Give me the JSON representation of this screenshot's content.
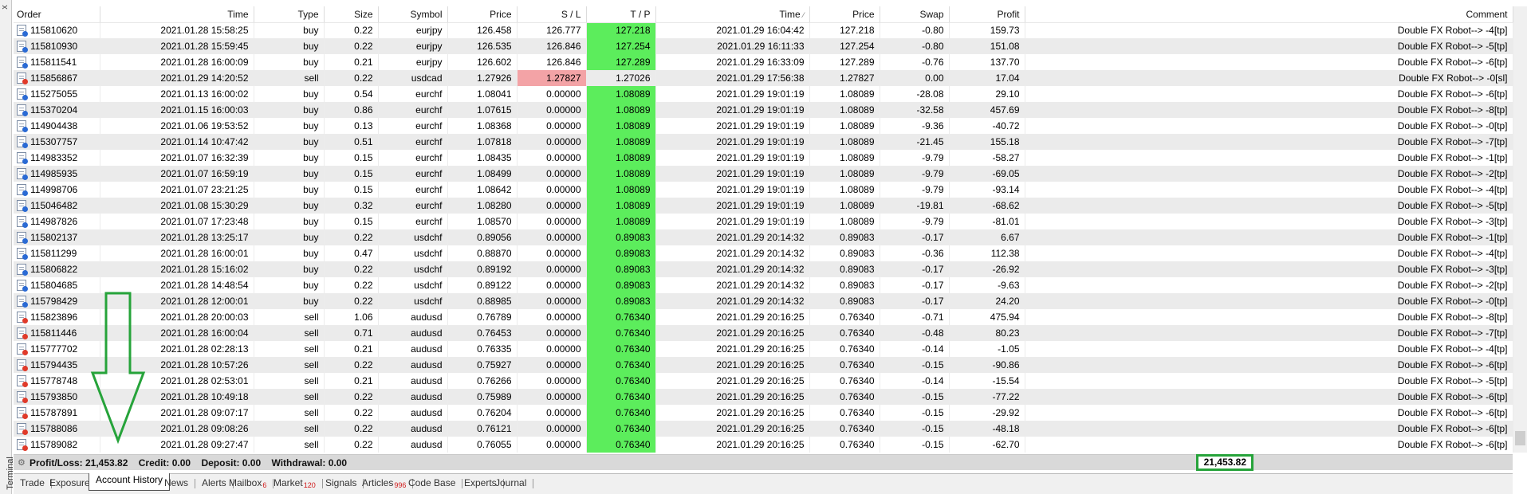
{
  "window": {
    "terminal_label": "Terminal",
    "close_glyph": "x"
  },
  "columns": {
    "order": "Order",
    "time": "Time",
    "type": "Type",
    "size": "Size",
    "symbol": "Symbol",
    "price": "Price",
    "sl": "S / L",
    "tp": "T / P",
    "close_time": "Time",
    "close_price": "Price",
    "swap": "Swap",
    "profit": "Profit",
    "comment": "Comment"
  },
  "rows": [
    {
      "order": "115810620",
      "time": "2021.01.28 15:58:25",
      "type": "buy",
      "size": "0.22",
      "symbol": "eurjpy",
      "price": "126.458",
      "sl": "126.777",
      "tp": "127.218",
      "close_time": "2021.01.29 16:04:42",
      "close_price": "127.218",
      "swap": "-0.80",
      "profit": "159.73",
      "comment": "Double FX Robot--> -4[tp]",
      "hit": "tp"
    },
    {
      "order": "115810930",
      "time": "2021.01.28 15:59:45",
      "type": "buy",
      "size": "0.22",
      "symbol": "eurjpy",
      "price": "126.535",
      "sl": "126.846",
      "tp": "127.254",
      "close_time": "2021.01.29 16:11:33",
      "close_price": "127.254",
      "swap": "-0.80",
      "profit": "151.08",
      "comment": "Double FX Robot--> -5[tp]",
      "hit": "tp"
    },
    {
      "order": "115811541",
      "time": "2021.01.28 16:00:09",
      "type": "buy",
      "size": "0.21",
      "symbol": "eurjpy",
      "price": "126.602",
      "sl": "126.846",
      "tp": "127.289",
      "close_time": "2021.01.29 16:33:09",
      "close_price": "127.289",
      "swap": "-0.76",
      "profit": "137.70",
      "comment": "Double FX Robot--> -6[tp]",
      "hit": "tp"
    },
    {
      "order": "115856867",
      "time": "2021.01.29 14:20:52",
      "type": "sell",
      "size": "0.22",
      "symbol": "usdcad",
      "price": "1.27926",
      "sl": "1.27827",
      "tp": "1.27026",
      "close_time": "2021.01.29 17:56:38",
      "close_price": "1.27827",
      "swap": "0.00",
      "profit": "17.04",
      "comment": "Double FX Robot--> -0[sl]",
      "hit": "sl"
    },
    {
      "order": "115275055",
      "time": "2021.01.13 16:00:02",
      "type": "buy",
      "size": "0.54",
      "symbol": "eurchf",
      "price": "1.08041",
      "sl": "0.00000",
      "tp": "1.08089",
      "close_time": "2021.01.29 19:01:19",
      "close_price": "1.08089",
      "swap": "-28.08",
      "profit": "29.10",
      "comment": "Double FX Robot--> -6[tp]",
      "hit": "tp"
    },
    {
      "order": "115370204",
      "time": "2021.01.15 16:00:03",
      "type": "buy",
      "size": "0.86",
      "symbol": "eurchf",
      "price": "1.07615",
      "sl": "0.00000",
      "tp": "1.08089",
      "close_time": "2021.01.29 19:01:19",
      "close_price": "1.08089",
      "swap": "-32.58",
      "profit": "457.69",
      "comment": "Double FX Robot--> -8[tp]",
      "hit": "tp"
    },
    {
      "order": "114904438",
      "time": "2021.01.06 19:53:52",
      "type": "buy",
      "size": "0.13",
      "symbol": "eurchf",
      "price": "1.08368",
      "sl": "0.00000",
      "tp": "1.08089",
      "close_time": "2021.01.29 19:01:19",
      "close_price": "1.08089",
      "swap": "-9.36",
      "profit": "-40.72",
      "comment": "Double FX Robot--> -0[tp]",
      "hit": "tp"
    },
    {
      "order": "115307757",
      "time": "2021.01.14 10:47:42",
      "type": "buy",
      "size": "0.51",
      "symbol": "eurchf",
      "price": "1.07818",
      "sl": "0.00000",
      "tp": "1.08089",
      "close_time": "2021.01.29 19:01:19",
      "close_price": "1.08089",
      "swap": "-21.45",
      "profit": "155.18",
      "comment": "Double FX Robot--> -7[tp]",
      "hit": "tp"
    },
    {
      "order": "114983352",
      "time": "2021.01.07 16:32:39",
      "type": "buy",
      "size": "0.15",
      "symbol": "eurchf",
      "price": "1.08435",
      "sl": "0.00000",
      "tp": "1.08089",
      "close_time": "2021.01.29 19:01:19",
      "close_price": "1.08089",
      "swap": "-9.79",
      "profit": "-58.27",
      "comment": "Double FX Robot--> -1[tp]",
      "hit": "tp"
    },
    {
      "order": "114985935",
      "time": "2021.01.07 16:59:19",
      "type": "buy",
      "size": "0.15",
      "symbol": "eurchf",
      "price": "1.08499",
      "sl": "0.00000",
      "tp": "1.08089",
      "close_time": "2021.01.29 19:01:19",
      "close_price": "1.08089",
      "swap": "-9.79",
      "profit": "-69.05",
      "comment": "Double FX Robot--> -2[tp]",
      "hit": "tp"
    },
    {
      "order": "114998706",
      "time": "2021.01.07 23:21:25",
      "type": "buy",
      "size": "0.15",
      "symbol": "eurchf",
      "price": "1.08642",
      "sl": "0.00000",
      "tp": "1.08089",
      "close_time": "2021.01.29 19:01:19",
      "close_price": "1.08089",
      "swap": "-9.79",
      "profit": "-93.14",
      "comment": "Double FX Robot--> -4[tp]",
      "hit": "tp"
    },
    {
      "order": "115046482",
      "time": "2021.01.08 15:30:29",
      "type": "buy",
      "size": "0.32",
      "symbol": "eurchf",
      "price": "1.08280",
      "sl": "0.00000",
      "tp": "1.08089",
      "close_time": "2021.01.29 19:01:19",
      "close_price": "1.08089",
      "swap": "-19.81",
      "profit": "-68.62",
      "comment": "Double FX Robot--> -5[tp]",
      "hit": "tp"
    },
    {
      "order": "114987826",
      "time": "2021.01.07 17:23:48",
      "type": "buy",
      "size": "0.15",
      "symbol": "eurchf",
      "price": "1.08570",
      "sl": "0.00000",
      "tp": "1.08089",
      "close_time": "2021.01.29 19:01:19",
      "close_price": "1.08089",
      "swap": "-9.79",
      "profit": "-81.01",
      "comment": "Double FX Robot--> -3[tp]",
      "hit": "tp"
    },
    {
      "order": "115802137",
      "time": "2021.01.28 13:25:17",
      "type": "buy",
      "size": "0.22",
      "symbol": "usdchf",
      "price": "0.89056",
      "sl": "0.00000",
      "tp": "0.89083",
      "close_time": "2021.01.29 20:14:32",
      "close_price": "0.89083",
      "swap": "-0.17",
      "profit": "6.67",
      "comment": "Double FX Robot--> -1[tp]",
      "hit": "tp"
    },
    {
      "order": "115811299",
      "time": "2021.01.28 16:00:01",
      "type": "buy",
      "size": "0.47",
      "symbol": "usdchf",
      "price": "0.88870",
      "sl": "0.00000",
      "tp": "0.89083",
      "close_time": "2021.01.29 20:14:32",
      "close_price": "0.89083",
      "swap": "-0.36",
      "profit": "112.38",
      "comment": "Double FX Robot--> -4[tp]",
      "hit": "tp"
    },
    {
      "order": "115806822",
      "time": "2021.01.28 15:16:02",
      "type": "buy",
      "size": "0.22",
      "symbol": "usdchf",
      "price": "0.89192",
      "sl": "0.00000",
      "tp": "0.89083",
      "close_time": "2021.01.29 20:14:32",
      "close_price": "0.89083",
      "swap": "-0.17",
      "profit": "-26.92",
      "comment": "Double FX Robot--> -3[tp]",
      "hit": "tp"
    },
    {
      "order": "115804685",
      "time": "2021.01.28 14:48:54",
      "type": "buy",
      "size": "0.22",
      "symbol": "usdchf",
      "price": "0.89122",
      "sl": "0.00000",
      "tp": "0.89083",
      "close_time": "2021.01.29 20:14:32",
      "close_price": "0.89083",
      "swap": "-0.17",
      "profit": "-9.63",
      "comment": "Double FX Robot--> -2[tp]",
      "hit": "tp"
    },
    {
      "order": "115798429",
      "time": "2021.01.28 12:00:01",
      "type": "buy",
      "size": "0.22",
      "symbol": "usdchf",
      "price": "0.88985",
      "sl": "0.00000",
      "tp": "0.89083",
      "close_time": "2021.01.29 20:14:32",
      "close_price": "0.89083",
      "swap": "-0.17",
      "profit": "24.20",
      "comment": "Double FX Robot--> -0[tp]",
      "hit": "tp"
    },
    {
      "order": "115823896",
      "time": "2021.01.28 20:00:03",
      "type": "sell",
      "size": "1.06",
      "symbol": "audusd",
      "price": "0.76789",
      "sl": "0.00000",
      "tp": "0.76340",
      "close_time": "2021.01.29 20:16:25",
      "close_price": "0.76340",
      "swap": "-0.71",
      "profit": "475.94",
      "comment": "Double FX Robot--> -8[tp]",
      "hit": "tp"
    },
    {
      "order": "115811446",
      "time": "2021.01.28 16:00:04",
      "type": "sell",
      "size": "0.71",
      "symbol": "audusd",
      "price": "0.76453",
      "sl": "0.00000",
      "tp": "0.76340",
      "close_time": "2021.01.29 20:16:25",
      "close_price": "0.76340",
      "swap": "-0.48",
      "profit": "80.23",
      "comment": "Double FX Robot--> -7[tp]",
      "hit": "tp"
    },
    {
      "order": "115777702",
      "time": "2021.01.28 02:28:13",
      "type": "sell",
      "size": "0.21",
      "symbol": "audusd",
      "price": "0.76335",
      "sl": "0.00000",
      "tp": "0.76340",
      "close_time": "2021.01.29 20:16:25",
      "close_price": "0.76340",
      "swap": "-0.14",
      "profit": "-1.05",
      "comment": "Double FX Robot--> -4[tp]",
      "hit": "tp"
    },
    {
      "order": "115794435",
      "time": "2021.01.28 10:57:26",
      "type": "sell",
      "size": "0.22",
      "symbol": "audusd",
      "price": "0.75927",
      "sl": "0.00000",
      "tp": "0.76340",
      "close_time": "2021.01.29 20:16:25",
      "close_price": "0.76340",
      "swap": "-0.15",
      "profit": "-90.86",
      "comment": "Double FX Robot--> -6[tp]",
      "hit": "tp"
    },
    {
      "order": "115778748",
      "time": "2021.01.28 02:53:01",
      "type": "sell",
      "size": "0.21",
      "symbol": "audusd",
      "price": "0.76266",
      "sl": "0.00000",
      "tp": "0.76340",
      "close_time": "2021.01.29 20:16:25",
      "close_price": "0.76340",
      "swap": "-0.14",
      "profit": "-15.54",
      "comment": "Double FX Robot--> -5[tp]",
      "hit": "tp"
    },
    {
      "order": "115793850",
      "time": "2021.01.28 10:49:18",
      "type": "sell",
      "size": "0.22",
      "symbol": "audusd",
      "price": "0.75989",
      "sl": "0.00000",
      "tp": "0.76340",
      "close_time": "2021.01.29 20:16:25",
      "close_price": "0.76340",
      "swap": "-0.15",
      "profit": "-77.22",
      "comment": "Double FX Robot--> -6[tp]",
      "hit": "tp"
    },
    {
      "order": "115787891",
      "time": "2021.01.28 09:07:17",
      "type": "sell",
      "size": "0.22",
      "symbol": "audusd",
      "price": "0.76204",
      "sl": "0.00000",
      "tp": "0.76340",
      "close_time": "2021.01.29 20:16:25",
      "close_price": "0.76340",
      "swap": "-0.15",
      "profit": "-29.92",
      "comment": "Double FX Robot--> -6[tp]",
      "hit": "tp"
    },
    {
      "order": "115788086",
      "time": "2021.01.28 09:08:26",
      "type": "sell",
      "size": "0.22",
      "symbol": "audusd",
      "price": "0.76121",
      "sl": "0.00000",
      "tp": "0.76340",
      "close_time": "2021.01.29 20:16:25",
      "close_price": "0.76340",
      "swap": "-0.15",
      "profit": "-48.18",
      "comment": "Double FX Robot--> -6[tp]",
      "hit": "tp"
    },
    {
      "order": "115789082",
      "time": "2021.01.28 09:27:47",
      "type": "sell",
      "size": "0.22",
      "symbol": "audusd",
      "price": "0.76055",
      "sl": "0.00000",
      "tp": "0.76340",
      "close_time": "2021.01.29 20:16:25",
      "close_price": "0.76340",
      "swap": "-0.15",
      "profit": "-62.70",
      "comment": "Double FX Robot--> -6[tp]",
      "hit": "tp"
    }
  ],
  "summary": {
    "profit_loss": "Profit/Loss: 21,453.82",
    "credit": "Credit: 0.00",
    "deposit": "Deposit: 0.00",
    "withdrawal": "Withdrawal: 0.00",
    "total_profit": "21,453.82"
  },
  "tabs": [
    {
      "label": "Trade",
      "badge": ""
    },
    {
      "label": "Exposure",
      "badge": ""
    },
    {
      "label": "Account History",
      "badge": "",
      "active": true
    },
    {
      "label": "News",
      "badge": ""
    },
    {
      "label": "Alerts",
      "badge": ""
    },
    {
      "label": "Mailbox",
      "badge": "6"
    },
    {
      "label": "Market",
      "badge": "120"
    },
    {
      "label": "Signals",
      "badge": ""
    },
    {
      "label": "Articles",
      "badge": "996"
    },
    {
      "label": "Code Base",
      "badge": ""
    },
    {
      "label": "Experts",
      "badge": ""
    },
    {
      "label": "Journal",
      "badge": ""
    }
  ],
  "colors": {
    "tp_hit": "#5ced5c",
    "sl_hit": "#f3a3a6",
    "annotation_green": "#26a33a",
    "badge_red": "#d01818"
  },
  "icons": {
    "buy_order": "order-buy-icon",
    "sell_order": "order-sell-icon",
    "annotation": "down-arrow-annotation"
  }
}
